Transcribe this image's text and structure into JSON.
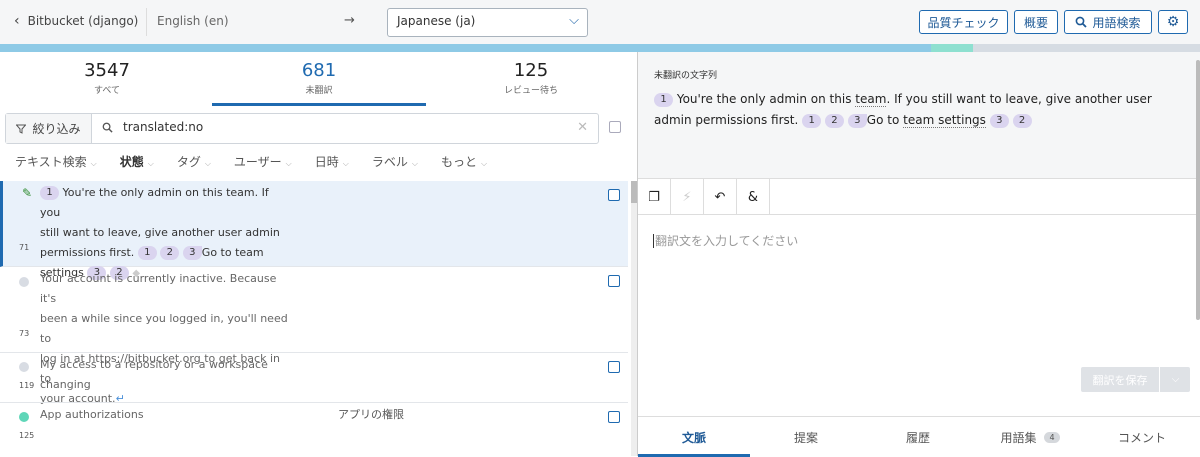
{
  "header": {
    "back_label": "Bitbucket (django)",
    "source_lang": "English (en)",
    "arrow": "→",
    "target_lang": "Japanese (ja)",
    "qa_button": "品質チェック",
    "overview_button": "概要",
    "glossary_button": "用語検索"
  },
  "progress": {
    "translated": 0.776,
    "unreviewed": 0.035,
    "untranslated": 0.189,
    "colors": {
      "translated": "#8ecae6",
      "unreviewed": "#8ee0d0",
      "untranslated": "#d6dce3"
    }
  },
  "stats": [
    {
      "count": "3547",
      "label": "すべて"
    },
    {
      "count": "681",
      "label": "未翻訳"
    },
    {
      "count": "125",
      "label": "レビュー待ち"
    }
  ],
  "filter": {
    "button_label": "絞り込み",
    "query": "translated:no"
  },
  "facets": [
    "テキスト検索",
    "状態",
    "タグ",
    "ユーザー",
    "日時",
    "ラベル",
    "もっと"
  ],
  "rows": [
    {
      "line1_tag": "1",
      "line1": "You're the only admin on this team. If you",
      "line2": "still want to leave, give another user admin",
      "line3_text": "permissions first.",
      "line3_tags": [
        "1",
        "2",
        "3"
      ],
      "line3_after": "Go to team",
      "line4_text": "settings",
      "line4_tags": [
        "3",
        "2"
      ],
      "number": "71"
    },
    {
      "lines": [
        "Your account is currently inactive. Because it's",
        "been a while since you logged in, you'll need to",
        "log in at https://bitbucket.org to get back in to",
        "your account."
      ],
      "number": "73"
    },
    {
      "lines": [
        "My access to a repository or a workspace",
        "changing"
      ],
      "number": "119"
    },
    {
      "lines": [
        "App authorizations"
      ],
      "translation": "アプリの権限",
      "number": "125"
    }
  ],
  "source_panel": {
    "title": "未翻訳の文字列",
    "tag1": "1",
    "text_a": "You're the only admin on this",
    "text_team": "team",
    "text_b": ". If you still want to leave, give another user admin permissions",
    "line2_start": "first.",
    "tags_mid": [
      "1",
      "2",
      "3"
    ],
    "go_to": "Go to",
    "team_settings": "team settings",
    "tags_end": [
      "3",
      "2"
    ]
  },
  "editor": {
    "placeholder": "翻訳文を入力してください",
    "save_label": "翻訳を保存"
  },
  "tabs": [
    {
      "label": "文脈"
    },
    {
      "label": "提案"
    },
    {
      "label": "履歴"
    },
    {
      "label": "用語集",
      "badge": "4"
    },
    {
      "label": "コメント"
    }
  ],
  "icons": [
    "chevron-left-icon",
    "chevron-down-icon",
    "search-icon",
    "gear-icon",
    "filter-icon",
    "clear-icon",
    "pencil-icon",
    "copy-icon",
    "lightning-icon",
    "undo-icon",
    "special-char-icon",
    "return-icon",
    "tag-icon"
  ]
}
